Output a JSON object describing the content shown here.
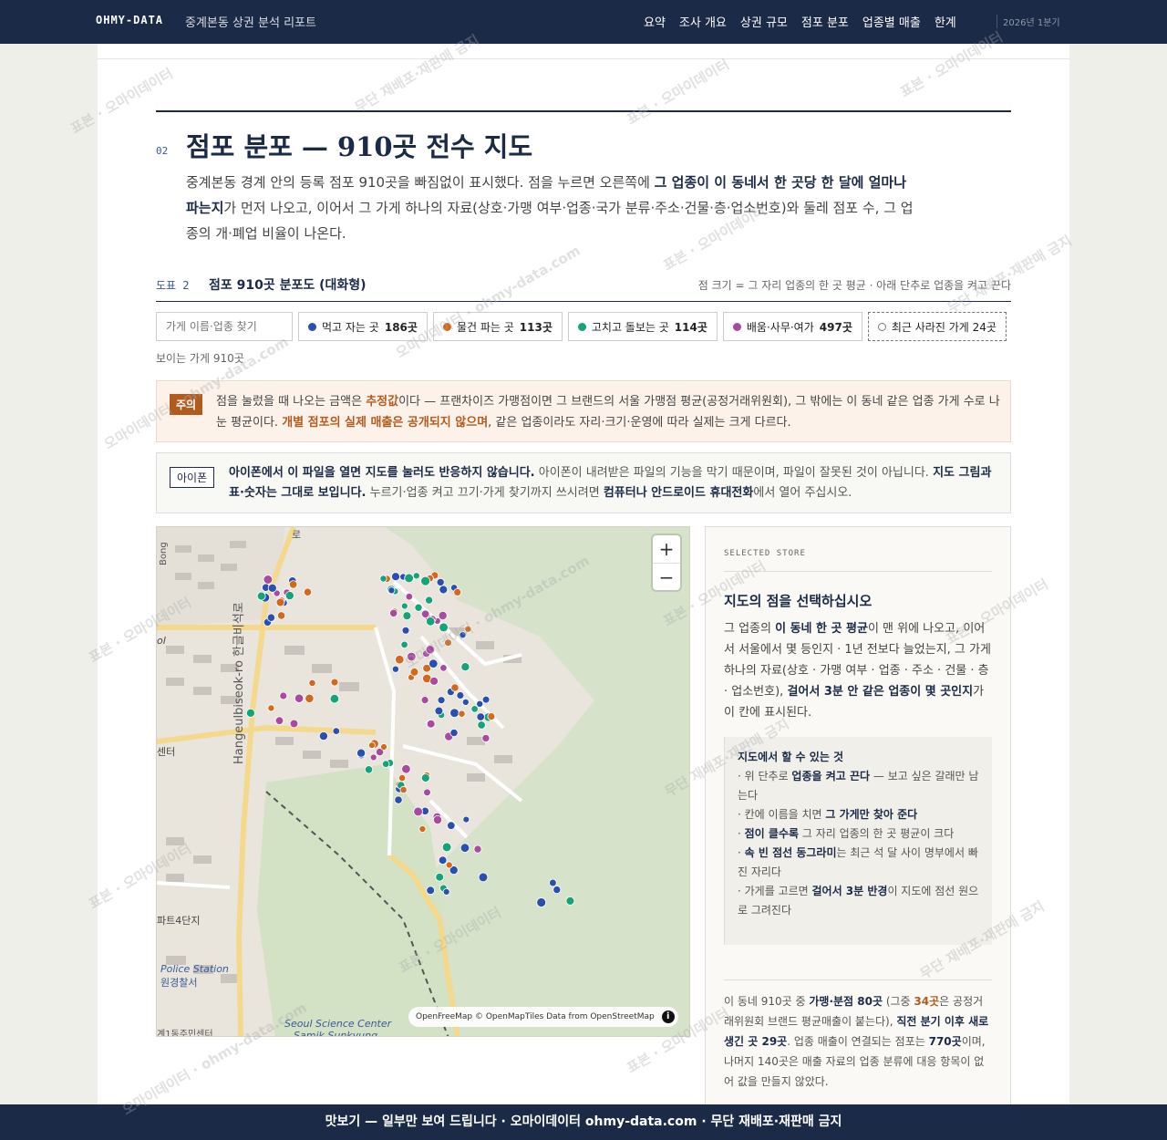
{
  "topbar": {
    "brand": "OHMY-DATA",
    "report_title": "중계본동 상권 분석 리포트",
    "nav": [
      "요약",
      "조사 개요",
      "상권 규모",
      "점포 분포",
      "업종별 매출",
      "한계"
    ],
    "date": "2026년 1분기"
  },
  "section": {
    "number": "02",
    "title": "점포 분포 — 910곳 전수 지도",
    "intro_1": "중계본동 경계 안의 등록 점포 910곳을 빠짐없이 표시했다. 점을 누르면 오른쪽에 ",
    "intro_bold": "그 업종이 이 동네서 한 곳당 한 달에 얼마나 파는지",
    "intro_2": "가 먼저 나오고, 이어서 그 가게 하나의 자료(상호·가맹 여부·업종·국가 분류·주소·건물·층·업소번호)와 둘레 점포 수, 그 업종의 개·폐업 비율이 나온다."
  },
  "figure": {
    "label": "도표 2",
    "title": "점포 910곳 분포도 (대화형)",
    "note": "점 크기 = 그 자리 업종의 한 곳 평균 · 아래 단추로 업종을 켜고 끈다"
  },
  "search": {
    "placeholder": "가게 이름·업종 찾기"
  },
  "filters": [
    {
      "label": "먹고 자는 곳",
      "count": "186곳",
      "color": "#2a4fae"
    },
    {
      "label": "물건 파는 곳",
      "count": "113곳",
      "color": "#d2691e"
    },
    {
      "label": "고치고 돌보는 곳",
      "count": "114곳",
      "color": "#15a37a"
    },
    {
      "label": "배움·사무·여가",
      "count": "497곳",
      "color": "#a84a9e"
    },
    {
      "label": "최근 사라진 가게 24곳",
      "count": "",
      "color": "#777777"
    }
  ],
  "visible_count": "보이는 가게 910곳",
  "caution": {
    "tag": "주의",
    "t1": "점을 눌렀을 때 나오는 금액은 ",
    "b1": "추정값",
    "t2": "이다 — 프랜차이즈 가맹점이면 그 브랜드의 서울 가맹점 평균(공정거래위원회), 그 밖에는 이 동네 같은 업종 가게 수로 나눈 평균이다. ",
    "b2": "개별 점포의 실제 매출은 공개되지 않으며",
    "t3": ", 같은 업종이라도 자리·크기·운영에 따라 실제는 크게 다르다."
  },
  "iphone": {
    "tag": "아이폰",
    "b1": "아이폰에서 이 파일을 열면 지도를 눌러도 반응하지 않습니다.",
    "t1": " 아이폰이 내려받은 파일의 기능을 막기 때문이며, 파일이 잘못된 것이 아닙니다. ",
    "b2": "지도 그림과 표·숫자는 그대로 보입니다.",
    "t2": " 누르기·업종 켜고 끄기·가게 찾기까지 쓰시려면 ",
    "b3": "컴퓨터나 안드로이드 휴대전화",
    "t3": "에서 열어 주십시오."
  },
  "map": {
    "zoom_in": "+",
    "zoom_out": "−",
    "attribution": "OpenFreeMap © OpenMapTiles Data from OpenStreetMap",
    "info": "i",
    "labels": {
      "road": "Hangeulbiseok-ro 한글비석로",
      "police_en": "Police Station",
      "police_ko": "원경찰서",
      "apt": "파트4단지",
      "center": "센터",
      "school": "ol",
      "science": "Seoul Science Center",
      "samik": "Samik Sunkyung",
      "community": "계1동주민센터",
      "ro": "로",
      "bong": "Bong"
    }
  },
  "panel": {
    "kicker": "SELECTED STORE",
    "head": "지도의 점을 선택하십시오",
    "body_1": "그 업종의 ",
    "body_b1": "이 동네 한 곳 평균",
    "body_2": "이 맨 위에 나오고, 이어서 서울에서 몇 등인지 · 1년 전보다 늘었는지, 그 가게 하나의 자료(상호 · 가맹 여부 · 업종 · 주소 · 건물 · 층 · 업소번호), ",
    "body_b2": "걸어서 3분 안 같은 업종이 몇 곳인지",
    "body_3": "가 이 칸에 표시된다.",
    "tips_title": "지도에서 할 수 있는 것",
    "tip1_a": "· 위 단추로 ",
    "tip1_b": "업종을 켜고 끈다",
    "tip1_c": " — 보고 싶은 갈래만 남는다",
    "tip2_a": "· 칸에 이름을 치면 ",
    "tip2_b": "그 가게만 찾아 준다",
    "tip3_a": "· ",
    "tip3_b": "점이 클수록",
    "tip3_c": " 그 자리 업종의 한 곳 평균이 크다",
    "tip4_a": "· ",
    "tip4_b": "속 빈 점선 동그라미",
    "tip4_c": "는 최근 석 달 사이 명부에서 빠진 자리다",
    "tip5_a": "· 가게를 고르면 ",
    "tip5_b": "걸어서 3분 반경",
    "tip5_c": "이 지도에 점선 원으로 그려진다",
    "foot_1": "이 동네 910곳 중 ",
    "foot_b1": "가맹·분점 80곳",
    "foot_2": " (그중 ",
    "foot_b2": "34곳",
    "foot_3": "은 공정거래위원회 브랜드 평균매출이 붙는다), ",
    "foot_b3": "직전 분기 이후 새로 생긴 곳 29곳",
    "foot_4": ". 업종 매출이 연결되는 점포는 ",
    "foot_b4": "770곳",
    "foot_5": "이며, 나머지 140곳은 매출 자료의 업종 분류에 대응 항목이 없어 값을 만들지 않았다."
  },
  "bottombar": "맛보기 — 일부만 보여 드립니다 · 오마이데이터 ohmy-data.com · 무단 재배포·재판매 금지",
  "watermark": {
    "a": "표본 · 오마이데이터",
    "b": "무단 재배포·재판매 금지",
    "c": "오마이데이터 · ohmy-data.com"
  }
}
